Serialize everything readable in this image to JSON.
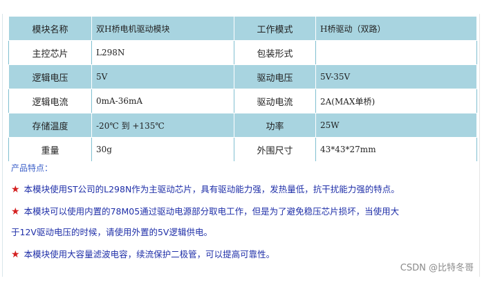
{
  "spec_table": {
    "rows": [
      {
        "k1": "模块名称",
        "v1": "双H桥电机驱动模块",
        "k2": "工作模式",
        "v2": "H桥驱动（双路）"
      },
      {
        "k1": "主控芯片",
        "v1": "L298N",
        "k2": "包装形式",
        "v2": ""
      },
      {
        "k1": "逻辑电压",
        "v1": "5V",
        "k2": "驱动电压",
        "v2": "5V-35V"
      },
      {
        "k1": "逻辑电流",
        "v1": "0mA-36mA",
        "k2": "驱动电流",
        "v2": "2A(MAX单桥)"
      },
      {
        "k1": "存储温度",
        "v1": "-20℃ 到 +135℃",
        "k2": "功率",
        "v2": "25W"
      },
      {
        "k1": "重量",
        "v1": "30g",
        "k2": "外围尺寸",
        "v2": "43*43*27mm"
      }
    ]
  },
  "features": {
    "title": "产品特点：",
    "star_glyph": "★",
    "items": [
      "本模块使用ST公司的L298N作为主驱动芯片，具有驱动能力强，发热量低，抗干扰能力强的特点。",
      "本模块可以使用内置的78M05通过驱动电源部分取电工作，但是为了避免稳压芯片损坏，当使用大",
      "于12V驱动电压的时候，请使用外置的5V逻辑供电。",
      "本模块使用大容量滤波电容，续流保护二极管，可以提高可靠性。"
    ]
  },
  "watermark": "CSDN @比特冬哥",
  "colors": {
    "row_fill": "#a8d4e0",
    "text_blue": "#1f2fa8",
    "star_red": "#d42020"
  }
}
